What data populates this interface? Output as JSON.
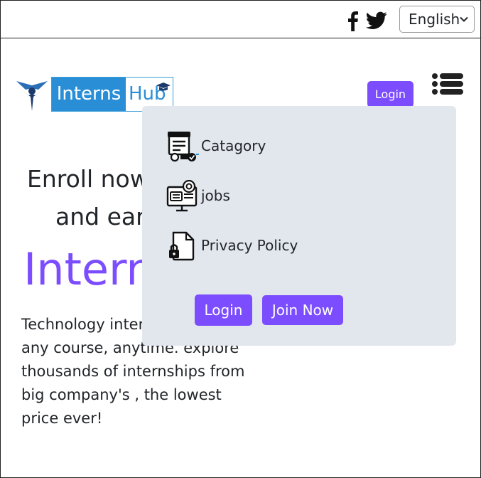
{
  "topbar": {
    "social": [
      "facebook-icon",
      "twitter-icon"
    ],
    "language": {
      "selected": "English"
    }
  },
  "header": {
    "logo": {
      "part1": "Interns",
      "part2": "Hub"
    },
    "login_label": "Login",
    "menu_icon": "list-icon"
  },
  "hero": {
    "line1": "Enroll now",
    "line2": "and earn",
    "big": "Intern",
    "description": "Technology intern trainings - any course, anytime. explore thousands of internships from big company's , the lowest price ever!"
  },
  "dropdown": {
    "items": [
      {
        "label": "Catagory",
        "icon": "certificate-icon"
      },
      {
        "label": "jobs",
        "icon": "computer-icon"
      },
      {
        "label": "Privacy Policy",
        "icon": "locked-document-icon"
      }
    ],
    "login_label": "Login",
    "join_label": "Join Now"
  },
  "colors": {
    "accent": "#7c4dff",
    "logo_blue": "#2a8ed6",
    "dropdown_bg": "#e2e7ee"
  }
}
